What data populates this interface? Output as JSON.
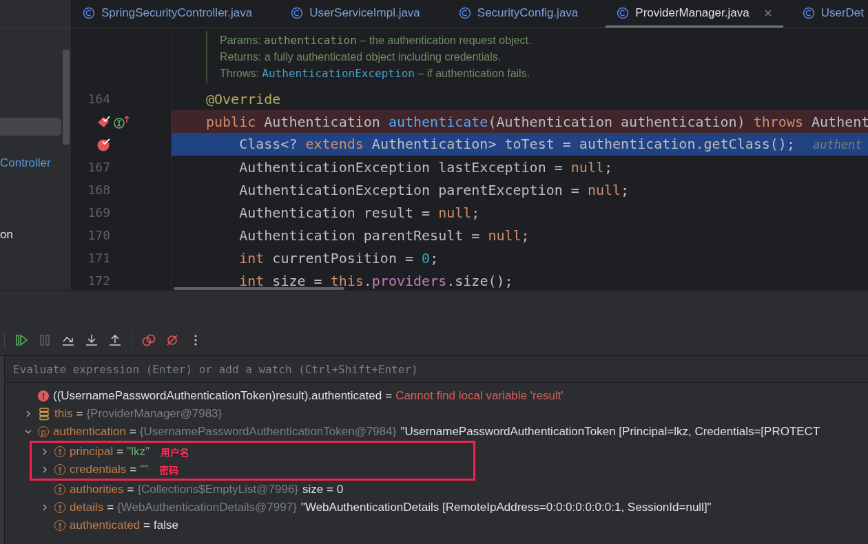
{
  "project_panel": {
    "items": [
      {
        "selected": true
      },
      {
        "label": "Controller",
        "selected": false,
        "modified": true
      },
      {
        "label": "on",
        "selected": false,
        "modified": false
      }
    ]
  },
  "editor": {
    "tabs": [
      {
        "label": "SpringSecurityController.java",
        "selected": false,
        "closable": false
      },
      {
        "label": "UserServiceImpl.java",
        "selected": false,
        "closable": false
      },
      {
        "label": "SecurityConfig.java",
        "selected": false,
        "closable": false
      },
      {
        "label": "ProviderManager.java",
        "selected": true,
        "closable": true
      },
      {
        "label": "UserDet",
        "selected": false,
        "closable": false
      }
    ],
    "doc_comment": [
      {
        "parts": [
          {
            "text": "Params: ",
            "kind": "label"
          },
          {
            "text": "authentication",
            "kind": "code"
          },
          {
            "text": " – the authentication request object.",
            "kind": "label"
          }
        ]
      },
      {
        "parts": [
          {
            "text": "Returns: a fully authenticated object including credentials.",
            "kind": "label"
          }
        ]
      },
      {
        "parts": [
          {
            "text": "Throws: ",
            "kind": "label"
          },
          {
            "text": "AuthenticationException",
            "kind": "link"
          },
          {
            "text": " – if authentication fails.",
            "kind": "label"
          }
        ]
      }
    ],
    "lines": [
      {
        "number": "164",
        "breakpoint": false,
        "execution_point": false,
        "tokens": [
          {
            "text": "@Override",
            "kind": "annotation"
          }
        ]
      },
      {
        "breakpoint": true,
        "execution_point": false,
        "markers": [
          {
            "kind": "breakpoint"
          },
          {
            "kind": "implements"
          }
        ],
        "tokens": [
          {
            "text": "public",
            "kind": "keyword"
          },
          {
            "text": " Authentication ",
            "kind": "plain"
          },
          {
            "text": "authenticate",
            "kind": "declaration"
          },
          {
            "text": "(Authentication authentication) ",
            "kind": "plain"
          },
          {
            "text": "throws",
            "kind": "keyword"
          },
          {
            "text": " Authent",
            "kind": "plain"
          }
        ]
      },
      {
        "breakpoint": true,
        "execution_point": true,
        "markers": [
          {
            "kind": "current-breakpoint"
          }
        ],
        "tokens": [
          {
            "text": "    Class<? ",
            "kind": "plain"
          },
          {
            "text": "extends",
            "kind": "keyword"
          },
          {
            "text": " Authentication> toTest = authentication.getClass();",
            "kind": "plain"
          },
          {
            "text": "authent",
            "kind": "hint"
          }
        ]
      },
      {
        "number": "167",
        "breakpoint": false,
        "execution_point": false,
        "tokens": [
          {
            "text": "    AuthenticationException lastException = ",
            "kind": "plain"
          },
          {
            "text": "null",
            "kind": "keyword"
          },
          {
            "text": ";",
            "kind": "plain"
          }
        ]
      },
      {
        "number": "168",
        "breakpoint": false,
        "execution_point": false,
        "tokens": [
          {
            "text": "    AuthenticationException parentException = ",
            "kind": "plain"
          },
          {
            "text": "null",
            "kind": "keyword"
          },
          {
            "text": ";",
            "kind": "plain"
          }
        ]
      },
      {
        "number": "169",
        "breakpoint": false,
        "execution_point": false,
        "tokens": [
          {
            "text": "    Authentication result = ",
            "kind": "plain"
          },
          {
            "text": "null",
            "kind": "keyword"
          },
          {
            "text": ";",
            "kind": "plain"
          }
        ]
      },
      {
        "number": "170",
        "breakpoint": false,
        "execution_point": false,
        "tokens": [
          {
            "text": "    Authentication parentResult = ",
            "kind": "plain"
          },
          {
            "text": "null",
            "kind": "keyword"
          },
          {
            "text": ";",
            "kind": "plain"
          }
        ]
      },
      {
        "number": "171",
        "breakpoint": false,
        "execution_point": false,
        "tokens": [
          {
            "text": "    int",
            "kind": "keyword"
          },
          {
            "text": " currentPosition = ",
            "kind": "plain"
          },
          {
            "text": "0",
            "kind": "number"
          },
          {
            "text": ";",
            "kind": "plain"
          }
        ]
      },
      {
        "number": "172",
        "breakpoint": false,
        "execution_point": false,
        "tokens": [
          {
            "text": "    int",
            "kind": "keyword"
          },
          {
            "text": " size = ",
            "kind": "plain"
          },
          {
            "text": "this",
            "kind": "keyword"
          },
          {
            "text": ".",
            "kind": "plain"
          },
          {
            "text": "providers",
            "kind": "field"
          },
          {
            "text": ".size();",
            "kind": "plain"
          }
        ]
      }
    ]
  },
  "debugger": {
    "toolbar": [
      {
        "kind": "resume",
        "disabled": false
      },
      {
        "kind": "pause",
        "disabled": true
      },
      {
        "kind": "step-over",
        "disabled": false
      },
      {
        "kind": "step-into",
        "disabled": false
      },
      {
        "kind": "step-out",
        "disabled": false
      },
      {
        "kind": "separator"
      },
      {
        "kind": "view-breakpoints",
        "disabled": false
      },
      {
        "kind": "mute-breakpoints",
        "disabled": false
      },
      {
        "kind": "more",
        "disabled": false
      }
    ],
    "watch_field": {
      "placeholder": "Evaluate expression (Enter) or add a watch (Ctrl+Shift+Enter)"
    },
    "variables": [
      {
        "kind": "error",
        "badge": "!",
        "expandable": false,
        "name": "((UsernamePasswordAuthenticationToken)result).authenticated",
        "separator": "=",
        "value": [
          {
            "text": "Cannot find local variable 'result'",
            "kind": "error"
          }
        ]
      },
      {
        "kind": "object",
        "expandable": true,
        "expanded": false,
        "name": "this",
        "separator": "=",
        "value": [
          {
            "text": "{ProviderManager@7983}",
            "kind": "ref"
          }
        ]
      },
      {
        "kind": "param",
        "badge": "p",
        "expandable": true,
        "expanded": true,
        "name": "authentication",
        "separator": "=",
        "value": [
          {
            "text": "{UsernamePasswordAuthenticationToken@7984}",
            "kind": "ref"
          },
          {
            "text": "\"UsernamePasswordAuthenticationToken [Principal=lkz, Credentials=[PROTECT",
            "kind": "plain"
          }
        ],
        "children": [
          {
            "kind": "field",
            "badge": "f",
            "expandable": true,
            "expanded": false,
            "name": "principal",
            "separator": "=",
            "value": [
              {
                "text": "\"lkz\"",
                "kind": "string"
              }
            ],
            "note": "用户名",
            "marked": true
          },
          {
            "kind": "field",
            "badge": "f",
            "expandable": true,
            "expanded": false,
            "name": "credentials",
            "separator": "=",
            "value": [
              {
                "text": "\"\"",
                "kind": "string"
              }
            ],
            "note": "密码",
            "marked": true
          },
          {
            "kind": "field",
            "badge": "f",
            "expandable": false,
            "name": "authorities",
            "separator": "=",
            "value": [
              {
                "text": "{Collections$EmptyList@7996}",
                "kind": "ref"
              },
              {
                "text": "size = 0",
                "kind": "plain"
              }
            ]
          },
          {
            "kind": "field",
            "badge": "f",
            "expandable": true,
            "expanded": false,
            "name": "details",
            "separator": "=",
            "value": [
              {
                "text": "{WebAuthenticationDetails@7997}",
                "kind": "ref"
              },
              {
                "text": "\"WebAuthenticationDetails [RemoteIpAddress=0:0:0:0:0:0:0:1, SessionId=null]\"",
                "kind": "plain"
              }
            ]
          },
          {
            "kind": "field",
            "badge": "f",
            "expandable": false,
            "name": "authenticated",
            "separator": "=",
            "value": [
              {
                "text": "false",
                "kind": "plain"
              }
            ]
          }
        ]
      }
    ]
  }
}
